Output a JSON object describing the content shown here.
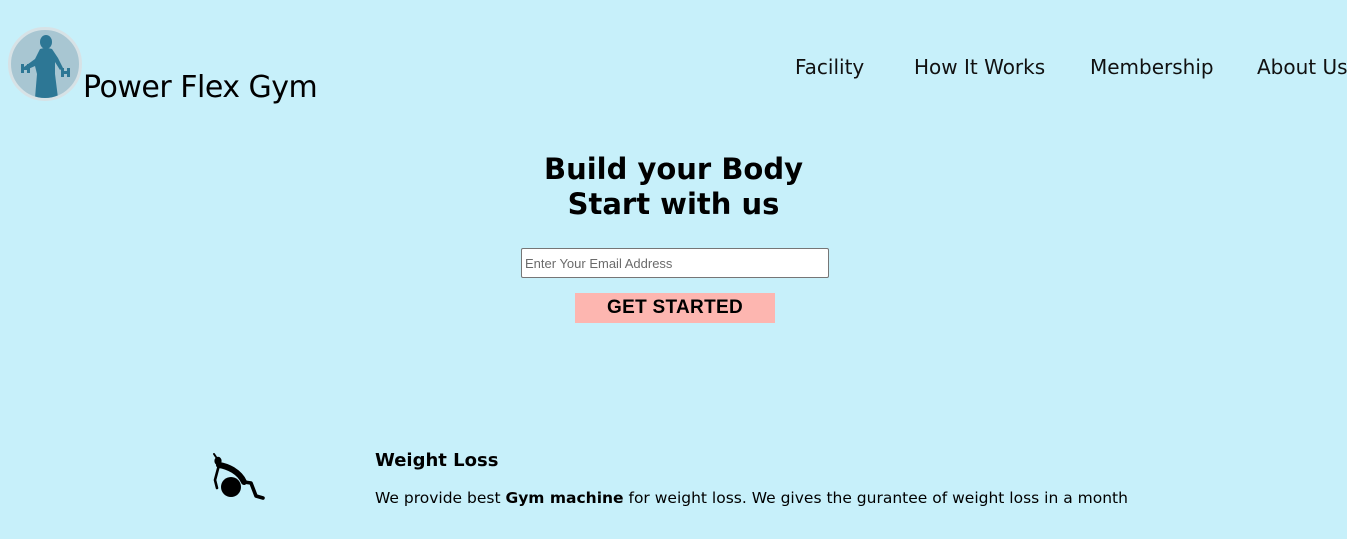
{
  "brand": {
    "name": "Power Flex Gym",
    "logo_icon": "gym-man-dumbbell-icon"
  },
  "nav": {
    "items": [
      {
        "label": "Facility"
      },
      {
        "label": "How It Works"
      },
      {
        "label": "Membership"
      },
      {
        "label": "About Us"
      }
    ]
  },
  "hero": {
    "line1": "Build your Body",
    "line2": "Start with us",
    "email_placeholder": "Enter Your Email Address",
    "email_value": "",
    "cta_label": "GET STARTED"
  },
  "features": [
    {
      "icon": "exercise-ball-person-icon",
      "title": "Weight Loss",
      "desc_before": "We provide best ",
      "desc_bold": "Gym machine",
      "desc_after": " for weight loss. We gives the gurantee of weight loss in a month"
    }
  ],
  "colors": {
    "background": "#c7f0fa",
    "cta_background": "#fdb6b0",
    "logo_figure": "#2d7795"
  }
}
